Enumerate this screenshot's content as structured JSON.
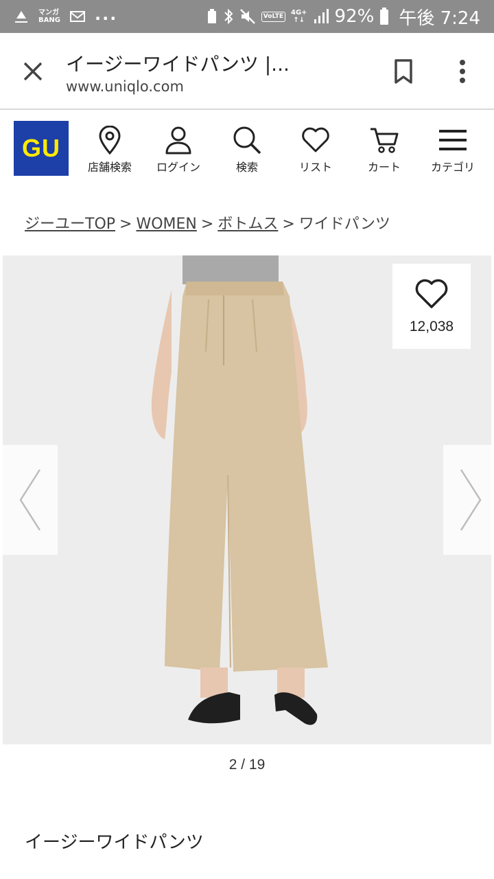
{
  "status_bar": {
    "manga_line1": "マンガ",
    "manga_line2": "BANG",
    "more": "...",
    "volte": "VoLTE",
    "network_line1": "4G+",
    "network_line2": "↑↓",
    "battery_percent": "92%",
    "time": "午後 7:24"
  },
  "browser": {
    "title": "イージーワイドパンツ |...",
    "url": "www.uniqlo.com"
  },
  "header": {
    "logo_text": "GU",
    "logo_color": "#1d3fa8",
    "logo_text_color": "#ffeb00",
    "nav": [
      {
        "label": "店舗検索",
        "icon": "location-pin-icon"
      },
      {
        "label": "ログイン",
        "icon": "user-icon"
      },
      {
        "label": "検索",
        "icon": "search-icon"
      },
      {
        "label": "リスト",
        "icon": "heart-icon"
      },
      {
        "label": "カート",
        "icon": "cart-icon"
      },
      {
        "label": "カテゴリ",
        "icon": "hamburger-menu-icon"
      }
    ]
  },
  "breadcrumb": {
    "items": [
      "ジーユーTOP",
      "WOMEN",
      "ボトムス"
    ],
    "current": "ワイドパンツ",
    "separator": ">"
  },
  "product": {
    "favorite_count": "12,038",
    "pager": "2 / 19",
    "name": "イージーワイドパンツ"
  }
}
